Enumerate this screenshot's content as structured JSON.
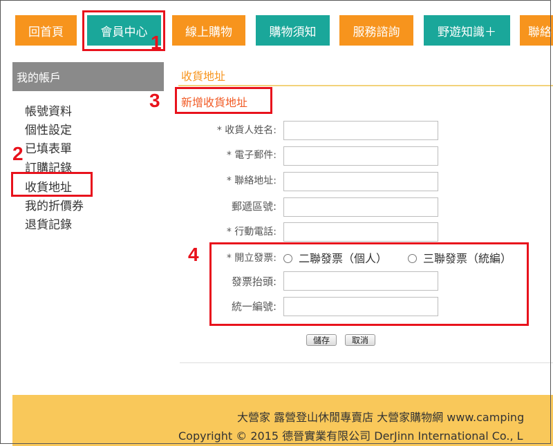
{
  "nav": {
    "items": [
      {
        "label": "回首頁"
      },
      {
        "label": "會員中心"
      },
      {
        "label": "線上購物"
      },
      {
        "label": "購物須知"
      },
      {
        "label": "服務諮詢"
      },
      {
        "label": "野遊知識＋"
      },
      {
        "label": "聯絡"
      }
    ]
  },
  "sidebar": {
    "title": "我的帳戶",
    "items": [
      {
        "label": "帳號資料"
      },
      {
        "label": "個性設定"
      },
      {
        "label": "已填表單"
      },
      {
        "label": "訂購記錄"
      },
      {
        "label": "收貨地址"
      },
      {
        "label": "我的折價券"
      },
      {
        "label": "退貨記錄"
      }
    ]
  },
  "main": {
    "section_title": "收貨地址",
    "subtitle": "新增收貨地址",
    "fields": {
      "name_label": "* 收貨人姓名:",
      "email_label": "* 電子郵件:",
      "address_label": "* 聯絡地址:",
      "zip_label": "郵遞區號:",
      "mobile_label": "* 行動電話:",
      "invoice_label": "* 開立發票:",
      "invoice_opt1": "二聯發票（個人）",
      "invoice_opt2": "三聯發票（統編）",
      "invoice_title_label": "發票抬頭:",
      "tax_id_label": "統一編號:"
    },
    "buttons": {
      "save": "儲存",
      "cancel": "取消"
    }
  },
  "footer": {
    "line1": "大營家 露營登山休閒專賣店 大營家購物網 www.camping",
    "line2": "Copyright © 2015 德晉實業有限公司 DerJinn International Co., L"
  },
  "annotations": {
    "n1": "1",
    "n2": "2",
    "n3": "3",
    "n4": "4"
  },
  "colors": {
    "orange": "#f7941d",
    "teal": "#1aa79a",
    "annotation_red": "#e8121c",
    "footer_bg": "#f9c85a"
  }
}
